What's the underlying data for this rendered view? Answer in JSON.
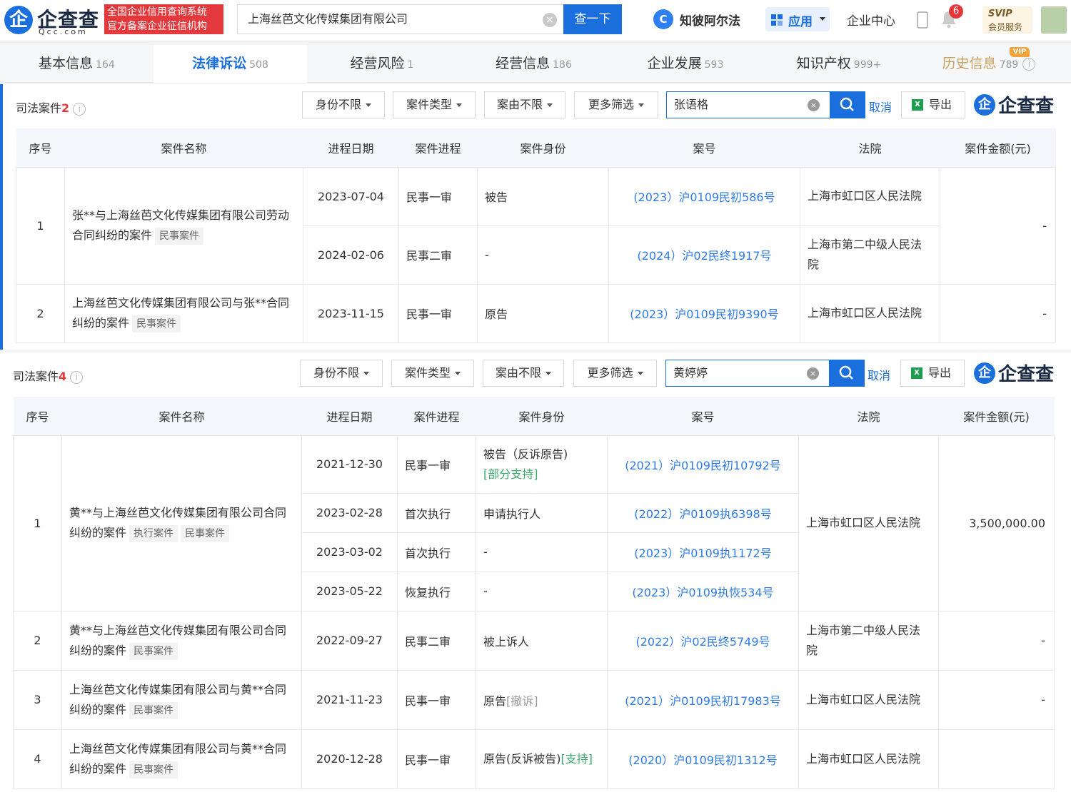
{
  "header": {
    "logo_char": "企",
    "logo_title": "企查查",
    "logo_sub": "Qcc.com",
    "slogan_line1": "全国企业信用查询系统",
    "slogan_line2": "官方备案企业征信机构",
    "search_value": "上海丝芭文化传媒集团有限公司",
    "search_btn": "查一下",
    "zbe_label": "知彼阿尔法",
    "apps_label": "应用",
    "enterprise_center": "企业中心",
    "notif_count": "6",
    "svip_line1": "SVIP",
    "svip_line2": "会员服务"
  },
  "tabs": [
    {
      "label": "基本信息",
      "count": "164"
    },
    {
      "label": "法律诉讼",
      "count": "508"
    },
    {
      "label": "经营风险",
      "count": "1"
    },
    {
      "label": "经营信息",
      "count": "186"
    },
    {
      "label": "企业发展",
      "count": "593"
    },
    {
      "label": "知识产权",
      "count": "999+"
    },
    {
      "label": "历史信息",
      "count": "789"
    }
  ],
  "vip_tag": "VIP",
  "filters": {
    "identity": "身份不限",
    "case_type": "案件类型",
    "cause": "案由不限",
    "more": "更多筛选",
    "cancel": "取消",
    "export": "导出",
    "brand": "企查查"
  },
  "columns": [
    "序号",
    "案件名称",
    "进程日期",
    "案件进程",
    "案件身份",
    "案号",
    "法院",
    "案件金额(元)"
  ],
  "panel1": {
    "title": "司法案件",
    "count": "2",
    "search_value": "张语格",
    "rows": [
      {
        "no": "1",
        "name": "张**与上海丝芭文化传媒集团有限公司劳动合同纠纷的案件",
        "tags": [
          "民事案件"
        ],
        "amount": "-",
        "steps": [
          {
            "date": "2023-07-04",
            "stage": "民事一审",
            "role": "被告",
            "case_no": "(2023）沪0109民初586号",
            "court": "上海市虹口区人民法院"
          },
          {
            "date": "2024-02-06",
            "stage": "民事二审",
            "role": "-",
            "case_no": "(2024）沪02民终1917号",
            "court": "上海市第二中级人民法院"
          }
        ]
      },
      {
        "no": "2",
        "name": "上海丝芭文化传媒集团有限公司与张**合同纠纷的案件",
        "tags": [
          "民事案件"
        ],
        "amount": "-",
        "steps": [
          {
            "date": "2023-11-15",
            "stage": "民事一审",
            "role": "原告",
            "case_no": "(2023）沪0109民初9390号",
            "court": "上海市虹口区人民法院"
          }
        ]
      }
    ]
  },
  "panel2": {
    "title": "司法案件",
    "count": "4",
    "search_value": "黄婷婷",
    "rows": [
      {
        "no": "1",
        "name": "黄**与上海丝芭文化传媒集团有限公司合同纠纷的案件",
        "tags": [
          "执行案件",
          "民事案件"
        ],
        "amount": "3,500,000.00",
        "court": "上海市虹口区人民法院",
        "steps": [
          {
            "date": "2021-12-30",
            "stage": "民事一审",
            "role": "被告（反诉原告)",
            "role_extra": "[部分支持]",
            "case_no": "(2021）沪0109民初10792号"
          },
          {
            "date": "2023-02-28",
            "stage": "首次执行",
            "role": "申请执行人",
            "case_no": "(2022）沪0109执6398号"
          },
          {
            "date": "2023-03-02",
            "stage": "首次执行",
            "role": "-",
            "case_no": "(2023）沪0109执1172号"
          },
          {
            "date": "2023-05-22",
            "stage": "恢复执行",
            "role": "-",
            "case_no": "(2023）沪0109执恢534号"
          }
        ]
      },
      {
        "no": "2",
        "name": "黄**与上海丝芭文化传媒集团有限公司合同纠纷的案件",
        "tags": [
          "民事案件"
        ],
        "amount": "-",
        "steps": [
          {
            "date": "2022-09-27",
            "stage": "民事二审",
            "role": "被上诉人",
            "case_no": "(2022）沪02民终5749号",
            "court": "上海市第二中级人民法院"
          }
        ]
      },
      {
        "no": "3",
        "name": "上海丝芭文化传媒集团有限公司与黄**合同纠纷的案件",
        "tags": [
          "民事案件"
        ],
        "amount": "-",
        "steps": [
          {
            "date": "2021-11-23",
            "stage": "民事一审",
            "role": "原告",
            "role_extra": "[撤诉]",
            "case_no": "(2021）沪0109民初17983号",
            "court": "上海市虹口区人民法院"
          }
        ]
      },
      {
        "no": "4",
        "name": "上海丝芭文化传媒集团有限公司与黄**合同纠纷的案件",
        "tags": [
          "民事案件"
        ],
        "amount": "",
        "steps": [
          {
            "date": "2020-12-28",
            "stage": "民事一审",
            "role": "原告(反诉被告)",
            "role_extra": "[支持]",
            "case_no": "(2020）沪0109民初1312号",
            "court": "上海市虹口区人民法院"
          }
        ]
      }
    ]
  }
}
